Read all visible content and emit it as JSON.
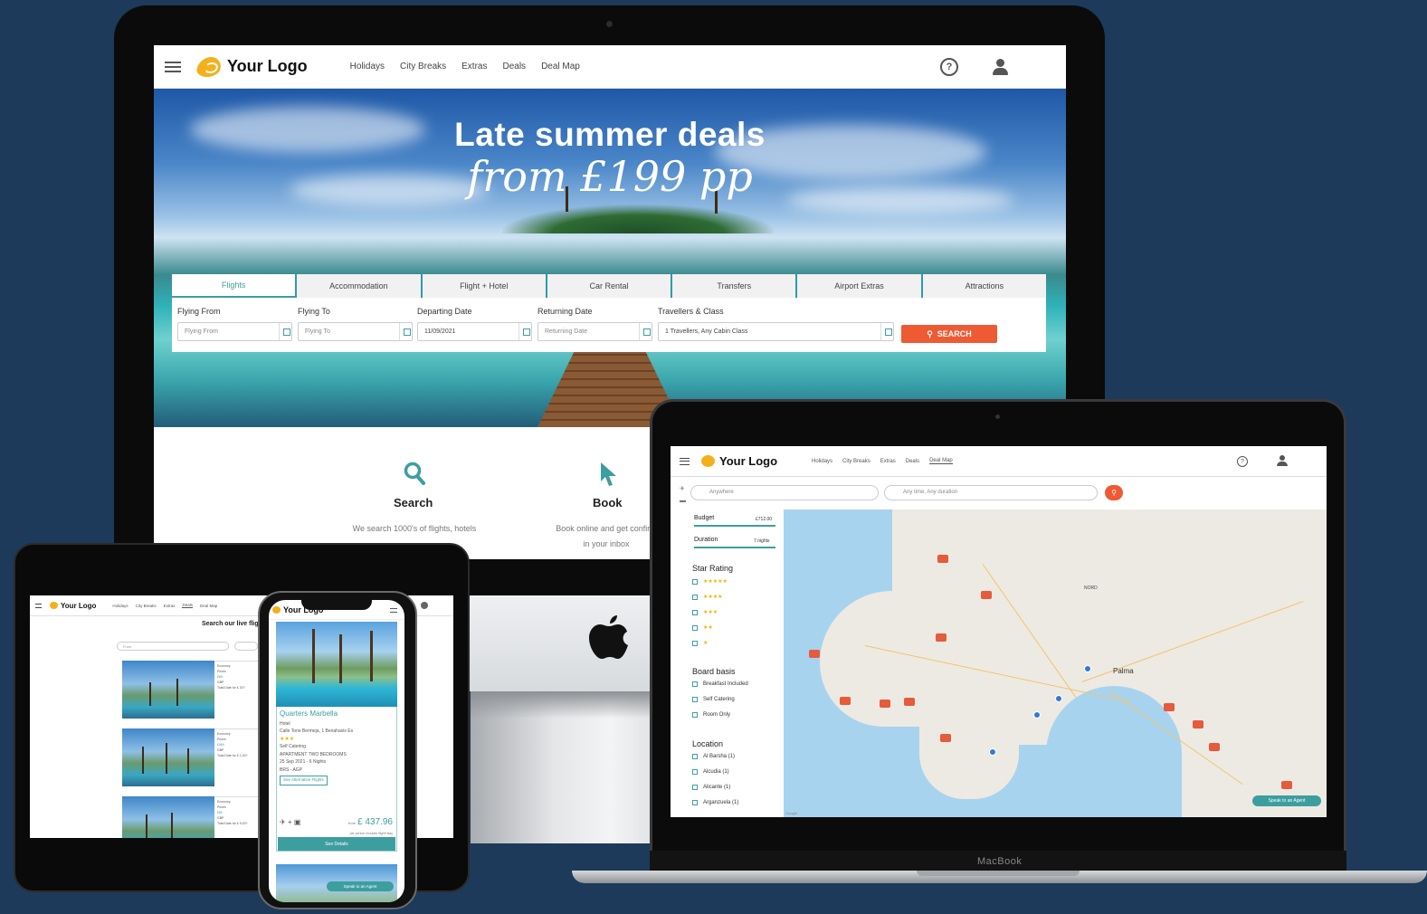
{
  "brand": {
    "logo_text": "Your Logo",
    "accent": "#3d9ea0",
    "cta": "#ee5a33",
    "logo_color": "#f4b01b"
  },
  "desktop": {
    "nav": {
      "links": [
        "Holidays",
        "City Breaks",
        "Extras",
        "Deals",
        "Deal Map"
      ],
      "help_icon": "?"
    },
    "hero": {
      "title": "Late summer deals",
      "subtitle": "from £199 pp"
    },
    "tabs": [
      "Flights",
      "Accommodation",
      "Flight + Hotel",
      "Car Rental",
      "Transfers",
      "Airport Extras",
      "Attractions"
    ],
    "fields": {
      "flying_from": {
        "label": "Flying From",
        "placeholder": "Flying From"
      },
      "flying_to": {
        "label": "Flying To",
        "placeholder": "Flying To"
      },
      "departing": {
        "label": "Departing Date",
        "value": "11/09/2021"
      },
      "returning": {
        "label": "Returning Date",
        "placeholder": "Returning Date"
      },
      "travellers": {
        "label": "Travellers & Class",
        "value": "1 Travellers, Any Cabin Class"
      }
    },
    "search_button": "SEARCH",
    "steps": [
      {
        "title": "Search",
        "desc1": "We search 1000's of flights, hotels"
      },
      {
        "title": "Book",
        "desc1": "Book online and get confirm",
        "desc2": "in your inbox"
      }
    ]
  },
  "tablet": {
    "nav_links": [
      "Holidays",
      "City Breaks",
      "Extras",
      "Deals",
      "Deal Map"
    ],
    "search_title": "Search our live flig",
    "input_placeholder": "From",
    "cards": [
      {
        "side": [
          "Economy",
          "Prices",
          "£89",
          "GBP",
          "Total Date for £ 20?"
        ]
      },
      {
        "side": [
          "Economy",
          "Prices",
          "£969",
          "GBP",
          "Total Date for £ 1,00?"
        ]
      },
      {
        "side": [
          "Economy",
          "Prices",
          "£89",
          "GBP",
          "Total Date for £ 9,00?"
        ]
      }
    ]
  },
  "phone": {
    "hotel_name": "Quarters Marbella",
    "type": "Hotel",
    "address": "Calle Tono Bermeja, 1 Benahavis Es",
    "stars": "★★★",
    "board": "Self Catering",
    "room": "APARTMENT TWO BEDROOMS",
    "dates": "25 Sep 2021 - 6 Nights",
    "airports": "BRS - AGP",
    "alt_flights": "See Alternative Flights",
    "price_from": "from",
    "price": "£ 437.96",
    "price_note": "per person includes flight+stay",
    "details_button": "See Details",
    "speak_button": "Speak to an Agent"
  },
  "laptop": {
    "nav_links": [
      "Holidays",
      "City Breaks",
      "Extras",
      "Deals",
      "Deal Map"
    ],
    "search_where": "Anywhere",
    "search_when": "Any time, Any duration",
    "filters": {
      "budget_label": "Budget",
      "budget_value": "£712.00",
      "duration_label": "Duration",
      "duration_value": "7 nights",
      "star_heading": "Star Rating",
      "stars": [
        "★★★★★",
        "★★★★",
        "★★★",
        "★★",
        "★"
      ],
      "board_heading": "Board basis",
      "board": [
        "Breakfast Included",
        "Self Catering",
        "Room Only"
      ],
      "location_heading": "Location",
      "locations": [
        "Al Barsha (1)",
        "Alcudia (1)",
        "Alicante (1)",
        "Arganzuela (1)"
      ]
    },
    "map": {
      "city": "Palma",
      "region": "NORD",
      "speak_button": "Speak to an Agent",
      "credit": "Google"
    },
    "device_label": "MacBook"
  }
}
